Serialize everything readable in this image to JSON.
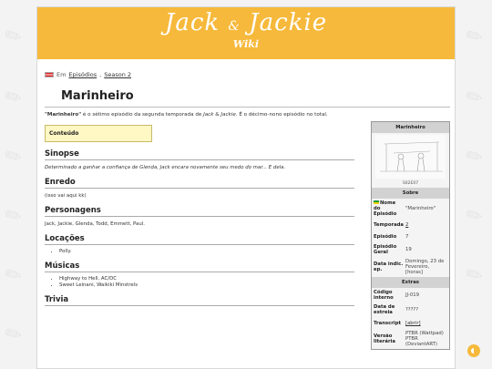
{
  "wiki": {
    "logo_main": "Jack",
    "logo_amp": "&",
    "logo_second": "Jackie",
    "logo_sub": "Wiki"
  },
  "breadcrumb": {
    "prefix": "Em",
    "links": [
      "Episódios",
      "Season 2"
    ]
  },
  "page_title": "Marinheiro",
  "intro": {
    "bold": "\"Marinheiro\"",
    "text1": " é o sétimo episódio da segunda temporada de ",
    "italic": "Jack & Jackie",
    "text2": ". É o décimo-nono episódio no total."
  },
  "toc_label": "Conteúdo",
  "sections": {
    "sinopse": {
      "title": "Sinopse",
      "text": "Determinado a ganhar a confiança de Glenda, Jack encara novamente seu medo do mar... E dela."
    },
    "enredo": {
      "title": "Enredo",
      "text": "(isso vai aqui kk)"
    },
    "personagens": {
      "title": "Personagens",
      "text": "Jack, Jackie, Glenda, Todd, Emmett, Paul."
    },
    "locacoes": {
      "title": "Locações",
      "items": [
        "Polly."
      ]
    },
    "musicas": {
      "title": "Músicas",
      "items": [
        "Highway to Hell, AC/DC",
        "Sweet Leinani, Waikiki Minstrels"
      ]
    },
    "trivia": {
      "title": "Trivia"
    }
  },
  "infobox": {
    "title": "Marinheiro",
    "caption": "S02E07",
    "sobre": "Sobre",
    "rows": [
      {
        "k": "Nome do Episódio",
        "v": "\"Marinheiro\""
      },
      {
        "k": "Temporada",
        "v": "2"
      },
      {
        "k": "Episódio",
        "v": "7"
      },
      {
        "k": "Episódio Geral",
        "v": "19"
      },
      {
        "k": "Data indic. ep.",
        "v": "Domingo, 23 de Fevereiro, [horas]"
      }
    ],
    "extras": "Extras",
    "rows2": [
      {
        "k": "Código interno",
        "v": "JJ-019"
      },
      {
        "k": "Data de estreia",
        "v": "?????"
      },
      {
        "k": "Transcript",
        "v": "[abrir]"
      },
      {
        "k": "Versão literária",
        "v": "PTBR (Wattpad) PTBR (DeviantART)"
      }
    ]
  }
}
